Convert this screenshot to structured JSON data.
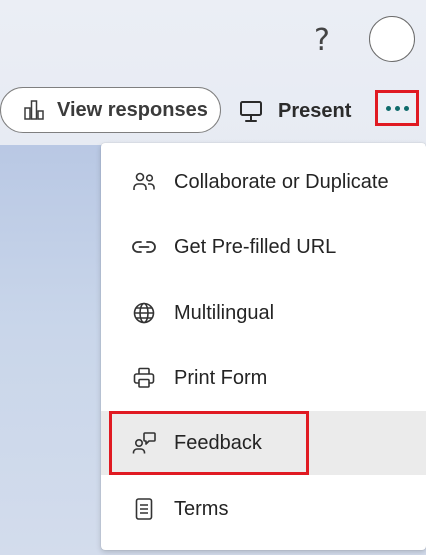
{
  "header": {
    "help_label": "?",
    "view_responses_label": "View responses",
    "present_label": "Present"
  },
  "menu": {
    "items": [
      {
        "label": "Collaborate or Duplicate",
        "icon": "people-icon"
      },
      {
        "label": "Get Pre-filled URL",
        "icon": "link-icon"
      },
      {
        "label": "Multilingual",
        "icon": "globe-icon"
      },
      {
        "label": "Print Form",
        "icon": "printer-icon"
      },
      {
        "label": "Feedback",
        "icon": "person-feedback-icon"
      },
      {
        "label": "Terms",
        "icon": "document-icon"
      }
    ]
  },
  "colors": {
    "accent": "#0f6b6b",
    "highlight": "#e01a22",
    "hover": "#ebebeb"
  }
}
